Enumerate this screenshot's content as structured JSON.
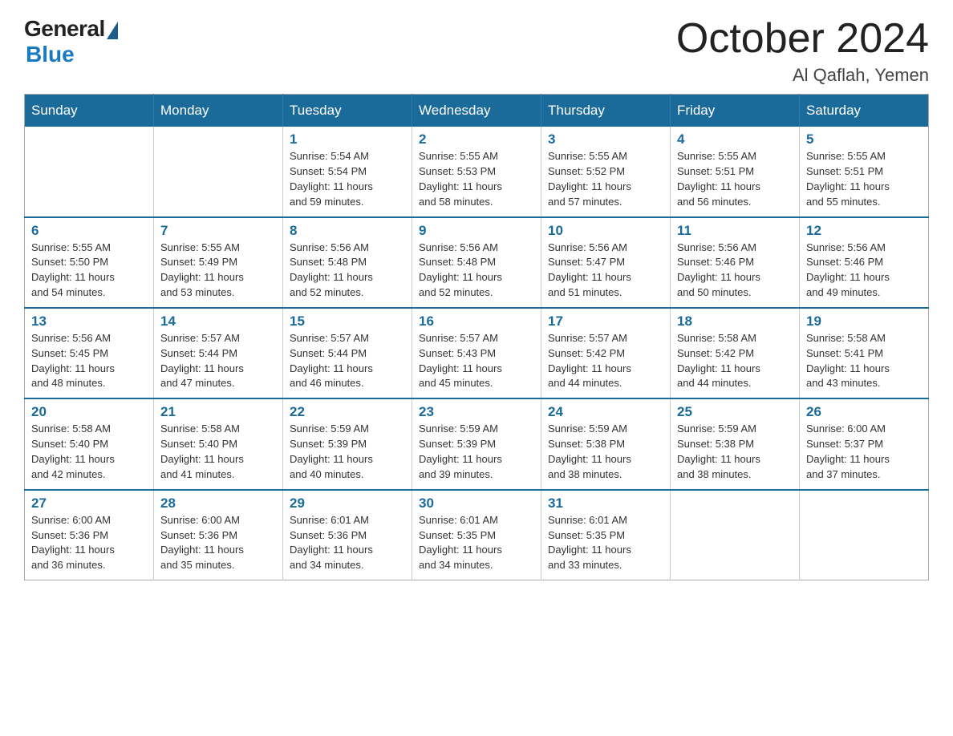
{
  "logo": {
    "general": "General",
    "blue": "Blue"
  },
  "title": "October 2024",
  "subtitle": "Al Qaflah, Yemen",
  "days_of_week": [
    "Sunday",
    "Monday",
    "Tuesday",
    "Wednesday",
    "Thursday",
    "Friday",
    "Saturday"
  ],
  "weeks": [
    [
      {
        "day": "",
        "info": ""
      },
      {
        "day": "",
        "info": ""
      },
      {
        "day": "1",
        "info": "Sunrise: 5:54 AM\nSunset: 5:54 PM\nDaylight: 11 hours\nand 59 minutes."
      },
      {
        "day": "2",
        "info": "Sunrise: 5:55 AM\nSunset: 5:53 PM\nDaylight: 11 hours\nand 58 minutes."
      },
      {
        "day": "3",
        "info": "Sunrise: 5:55 AM\nSunset: 5:52 PM\nDaylight: 11 hours\nand 57 minutes."
      },
      {
        "day": "4",
        "info": "Sunrise: 5:55 AM\nSunset: 5:51 PM\nDaylight: 11 hours\nand 56 minutes."
      },
      {
        "day": "5",
        "info": "Sunrise: 5:55 AM\nSunset: 5:51 PM\nDaylight: 11 hours\nand 55 minutes."
      }
    ],
    [
      {
        "day": "6",
        "info": "Sunrise: 5:55 AM\nSunset: 5:50 PM\nDaylight: 11 hours\nand 54 minutes."
      },
      {
        "day": "7",
        "info": "Sunrise: 5:55 AM\nSunset: 5:49 PM\nDaylight: 11 hours\nand 53 minutes."
      },
      {
        "day": "8",
        "info": "Sunrise: 5:56 AM\nSunset: 5:48 PM\nDaylight: 11 hours\nand 52 minutes."
      },
      {
        "day": "9",
        "info": "Sunrise: 5:56 AM\nSunset: 5:48 PM\nDaylight: 11 hours\nand 52 minutes."
      },
      {
        "day": "10",
        "info": "Sunrise: 5:56 AM\nSunset: 5:47 PM\nDaylight: 11 hours\nand 51 minutes."
      },
      {
        "day": "11",
        "info": "Sunrise: 5:56 AM\nSunset: 5:46 PM\nDaylight: 11 hours\nand 50 minutes."
      },
      {
        "day": "12",
        "info": "Sunrise: 5:56 AM\nSunset: 5:46 PM\nDaylight: 11 hours\nand 49 minutes."
      }
    ],
    [
      {
        "day": "13",
        "info": "Sunrise: 5:56 AM\nSunset: 5:45 PM\nDaylight: 11 hours\nand 48 minutes."
      },
      {
        "day": "14",
        "info": "Sunrise: 5:57 AM\nSunset: 5:44 PM\nDaylight: 11 hours\nand 47 minutes."
      },
      {
        "day": "15",
        "info": "Sunrise: 5:57 AM\nSunset: 5:44 PM\nDaylight: 11 hours\nand 46 minutes."
      },
      {
        "day": "16",
        "info": "Sunrise: 5:57 AM\nSunset: 5:43 PM\nDaylight: 11 hours\nand 45 minutes."
      },
      {
        "day": "17",
        "info": "Sunrise: 5:57 AM\nSunset: 5:42 PM\nDaylight: 11 hours\nand 44 minutes."
      },
      {
        "day": "18",
        "info": "Sunrise: 5:58 AM\nSunset: 5:42 PM\nDaylight: 11 hours\nand 44 minutes."
      },
      {
        "day": "19",
        "info": "Sunrise: 5:58 AM\nSunset: 5:41 PM\nDaylight: 11 hours\nand 43 minutes."
      }
    ],
    [
      {
        "day": "20",
        "info": "Sunrise: 5:58 AM\nSunset: 5:40 PM\nDaylight: 11 hours\nand 42 minutes."
      },
      {
        "day": "21",
        "info": "Sunrise: 5:58 AM\nSunset: 5:40 PM\nDaylight: 11 hours\nand 41 minutes."
      },
      {
        "day": "22",
        "info": "Sunrise: 5:59 AM\nSunset: 5:39 PM\nDaylight: 11 hours\nand 40 minutes."
      },
      {
        "day": "23",
        "info": "Sunrise: 5:59 AM\nSunset: 5:39 PM\nDaylight: 11 hours\nand 39 minutes."
      },
      {
        "day": "24",
        "info": "Sunrise: 5:59 AM\nSunset: 5:38 PM\nDaylight: 11 hours\nand 38 minutes."
      },
      {
        "day": "25",
        "info": "Sunrise: 5:59 AM\nSunset: 5:38 PM\nDaylight: 11 hours\nand 38 minutes."
      },
      {
        "day": "26",
        "info": "Sunrise: 6:00 AM\nSunset: 5:37 PM\nDaylight: 11 hours\nand 37 minutes."
      }
    ],
    [
      {
        "day": "27",
        "info": "Sunrise: 6:00 AM\nSunset: 5:36 PM\nDaylight: 11 hours\nand 36 minutes."
      },
      {
        "day": "28",
        "info": "Sunrise: 6:00 AM\nSunset: 5:36 PM\nDaylight: 11 hours\nand 35 minutes."
      },
      {
        "day": "29",
        "info": "Sunrise: 6:01 AM\nSunset: 5:36 PM\nDaylight: 11 hours\nand 34 minutes."
      },
      {
        "day": "30",
        "info": "Sunrise: 6:01 AM\nSunset: 5:35 PM\nDaylight: 11 hours\nand 34 minutes."
      },
      {
        "day": "31",
        "info": "Sunrise: 6:01 AM\nSunset: 5:35 PM\nDaylight: 11 hours\nand 33 minutes."
      },
      {
        "day": "",
        "info": ""
      },
      {
        "day": "",
        "info": ""
      }
    ]
  ]
}
